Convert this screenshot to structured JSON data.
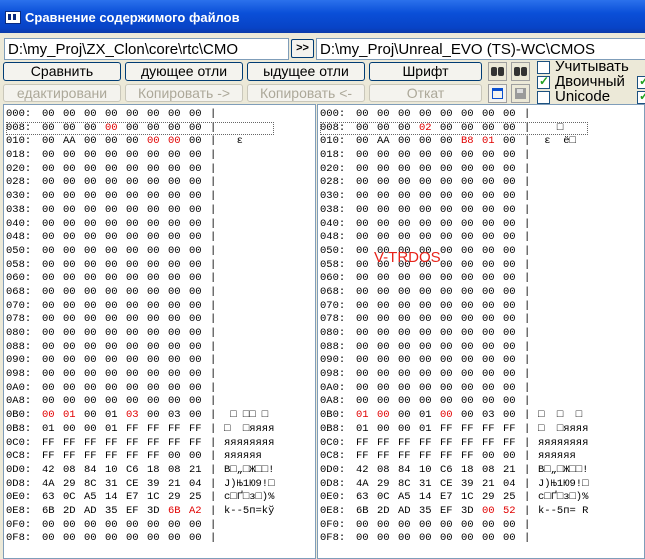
{
  "window": {
    "title": "Сравнение содержимого файлов"
  },
  "left_path": "D:\\my_Proj\\ZX_Clon\\core\\rtc\\CMO",
  "right_path": "D:\\my_Proj\\Unreal_EVO (TS)-WC\\CMOS",
  "swap_label": ">>",
  "buttons": {
    "compare": "Сравнить",
    "next_diff": "дующее отли",
    "prev_diff": "ыдущее отли",
    "font": "Шрифт",
    "edit": "едактировани",
    "copy_right": "Копировать ->",
    "copy_left": "Копировать <-",
    "rollback": "Откат"
  },
  "options": {
    "consider": {
      "label": "Учитывать",
      "checked": false
    },
    "binary": {
      "label": "Двоичный",
      "checked": true
    },
    "unicode": {
      "label": "Unicode",
      "checked": false
    }
  },
  "overlay_text": "V-TRDOS",
  "left_rows": [
    {
      "addr": "000:",
      "bytes": [
        "00",
        "00",
        "00",
        "00",
        "00",
        "00",
        "00",
        "00"
      ],
      "ascii": ""
    },
    {
      "addr": "008:",
      "bytes": [
        "00",
        "00",
        "00",
        "00",
        "00",
        "00",
        "00",
        "00"
      ],
      "ascii": ""
    },
    {
      "addr": "010:",
      "bytes": [
        "00",
        "AA",
        "00",
        "00",
        "00",
        "00",
        "00",
        "00"
      ],
      "ascii": "  ε"
    },
    {
      "addr": "018:",
      "bytes": [
        "00",
        "00",
        "00",
        "00",
        "00",
        "00",
        "00",
        "00"
      ],
      "ascii": ""
    },
    {
      "addr": "020:",
      "bytes": [
        "00",
        "00",
        "00",
        "00",
        "00",
        "00",
        "00",
        "00"
      ],
      "ascii": ""
    },
    {
      "addr": "028:",
      "bytes": [
        "00",
        "00",
        "00",
        "00",
        "00",
        "00",
        "00",
        "00"
      ],
      "ascii": ""
    },
    {
      "addr": "030:",
      "bytes": [
        "00",
        "00",
        "00",
        "00",
        "00",
        "00",
        "00",
        "00"
      ],
      "ascii": ""
    },
    {
      "addr": "038:",
      "bytes": [
        "00",
        "00",
        "00",
        "00",
        "00",
        "00",
        "00",
        "00"
      ],
      "ascii": ""
    },
    {
      "addr": "040:",
      "bytes": [
        "00",
        "00",
        "00",
        "00",
        "00",
        "00",
        "00",
        "00"
      ],
      "ascii": ""
    },
    {
      "addr": "048:",
      "bytes": [
        "00",
        "00",
        "00",
        "00",
        "00",
        "00",
        "00",
        "00"
      ],
      "ascii": ""
    },
    {
      "addr": "050:",
      "bytes": [
        "00",
        "00",
        "00",
        "00",
        "00",
        "00",
        "00",
        "00"
      ],
      "ascii": ""
    },
    {
      "addr": "058:",
      "bytes": [
        "00",
        "00",
        "00",
        "00",
        "00",
        "00",
        "00",
        "00"
      ],
      "ascii": ""
    },
    {
      "addr": "060:",
      "bytes": [
        "00",
        "00",
        "00",
        "00",
        "00",
        "00",
        "00",
        "00"
      ],
      "ascii": ""
    },
    {
      "addr": "068:",
      "bytes": [
        "00",
        "00",
        "00",
        "00",
        "00",
        "00",
        "00",
        "00"
      ],
      "ascii": ""
    },
    {
      "addr": "070:",
      "bytes": [
        "00",
        "00",
        "00",
        "00",
        "00",
        "00",
        "00",
        "00"
      ],
      "ascii": ""
    },
    {
      "addr": "078:",
      "bytes": [
        "00",
        "00",
        "00",
        "00",
        "00",
        "00",
        "00",
        "00"
      ],
      "ascii": ""
    },
    {
      "addr": "080:",
      "bytes": [
        "00",
        "00",
        "00",
        "00",
        "00",
        "00",
        "00",
        "00"
      ],
      "ascii": ""
    },
    {
      "addr": "088:",
      "bytes": [
        "00",
        "00",
        "00",
        "00",
        "00",
        "00",
        "00",
        "00"
      ],
      "ascii": ""
    },
    {
      "addr": "090:",
      "bytes": [
        "00",
        "00",
        "00",
        "00",
        "00",
        "00",
        "00",
        "00"
      ],
      "ascii": ""
    },
    {
      "addr": "098:",
      "bytes": [
        "00",
        "00",
        "00",
        "00",
        "00",
        "00",
        "00",
        "00"
      ],
      "ascii": ""
    },
    {
      "addr": "0A0:",
      "bytes": [
        "00",
        "00",
        "00",
        "00",
        "00",
        "00",
        "00",
        "00"
      ],
      "ascii": ""
    },
    {
      "addr": "0A8:",
      "bytes": [
        "00",
        "00",
        "00",
        "00",
        "00",
        "00",
        "00",
        "00"
      ],
      "ascii": ""
    },
    {
      "addr": "0B0:",
      "bytes": [
        "00",
        "01",
        "00",
        "01",
        "03",
        "00",
        "03",
        "00"
      ],
      "ascii": " □ □□ □"
    },
    {
      "addr": "0B8:",
      "bytes": [
        "01",
        "00",
        "00",
        "01",
        "FF",
        "FF",
        "FF",
        "FF"
      ],
      "ascii": "□  □яяяя"
    },
    {
      "addr": "0C0:",
      "bytes": [
        "FF",
        "FF",
        "FF",
        "FF",
        "FF",
        "FF",
        "FF",
        "FF"
      ],
      "ascii": "яяяяяяяя"
    },
    {
      "addr": "0C8:",
      "bytes": [
        "FF",
        "FF",
        "FF",
        "FF",
        "FF",
        "FF",
        "00",
        "00"
      ],
      "ascii": "яяяяяя"
    },
    {
      "addr": "0D0:",
      "bytes": [
        "42",
        "08",
        "84",
        "10",
        "C6",
        "18",
        "08",
        "21"
      ],
      "ascii": "B□„□Ж□□!"
    },
    {
      "addr": "0D8:",
      "bytes": [
        "4A",
        "29",
        "8C",
        "31",
        "CE",
        "39",
        "21",
        "04"
      ],
      "ascii": "J)Њ1Ю9!□"
    },
    {
      "addr": "0E0:",
      "bytes": [
        "63",
        "0C",
        "A5",
        "14",
        "E7",
        "1C",
        "29",
        "25"
      ],
      "ascii": "c□Ґ□з□)%"
    },
    {
      "addr": "0E8:",
      "bytes": [
        "6B",
        "2D",
        "AD",
        "35",
        "EF",
        "3D",
        "6B",
        "A2"
      ],
      "ascii": "k--5п=kў"
    },
    {
      "addr": "0F0:",
      "bytes": [
        "00",
        "00",
        "00",
        "00",
        "00",
        "00",
        "00",
        "00"
      ],
      "ascii": ""
    },
    {
      "addr": "0F8:",
      "bytes": [
        "00",
        "00",
        "00",
        "00",
        "00",
        "00",
        "00",
        "00"
      ],
      "ascii": ""
    }
  ],
  "right_rows": [
    {
      "addr": "000:",
      "bytes": [
        "00",
        "00",
        "00",
        "00",
        "00",
        "00",
        "00",
        "00"
      ],
      "ascii": ""
    },
    {
      "addr": "008:",
      "bytes": [
        "00",
        "00",
        "00",
        "02",
        "00",
        "00",
        "00",
        "00"
      ],
      "ascii": "   □"
    },
    {
      "addr": "010:",
      "bytes": [
        "00",
        "AA",
        "00",
        "00",
        "00",
        "B8",
        "01",
        "00"
      ],
      "ascii": " ε  ё□"
    },
    {
      "addr": "018:",
      "bytes": [
        "00",
        "00",
        "00",
        "00",
        "00",
        "00",
        "00",
        "00"
      ],
      "ascii": ""
    },
    {
      "addr": "020:",
      "bytes": [
        "00",
        "00",
        "00",
        "00",
        "00",
        "00",
        "00",
        "00"
      ],
      "ascii": ""
    },
    {
      "addr": "028:",
      "bytes": [
        "00",
        "00",
        "00",
        "00",
        "00",
        "00",
        "00",
        "00"
      ],
      "ascii": ""
    },
    {
      "addr": "030:",
      "bytes": [
        "00",
        "00",
        "00",
        "00",
        "00",
        "00",
        "00",
        "00"
      ],
      "ascii": ""
    },
    {
      "addr": "038:",
      "bytes": [
        "00",
        "00",
        "00",
        "00",
        "00",
        "00",
        "00",
        "00"
      ],
      "ascii": ""
    },
    {
      "addr": "040:",
      "bytes": [
        "00",
        "00",
        "00",
        "00",
        "00",
        "00",
        "00",
        "00"
      ],
      "ascii": ""
    },
    {
      "addr": "048:",
      "bytes": [
        "00",
        "00",
        "00",
        "00",
        "00",
        "00",
        "00",
        "00"
      ],
      "ascii": ""
    },
    {
      "addr": "050:",
      "bytes": [
        "00",
        "00",
        "00",
        "00",
        "00",
        "00",
        "00",
        "00"
      ],
      "ascii": ""
    },
    {
      "addr": "058:",
      "bytes": [
        "00",
        "00",
        "00",
        "00",
        "00",
        "00",
        "00",
        "00"
      ],
      "ascii": ""
    },
    {
      "addr": "060:",
      "bytes": [
        "00",
        "00",
        "00",
        "00",
        "00",
        "00",
        "00",
        "00"
      ],
      "ascii": ""
    },
    {
      "addr": "068:",
      "bytes": [
        "00",
        "00",
        "00",
        "00",
        "00",
        "00",
        "00",
        "00"
      ],
      "ascii": ""
    },
    {
      "addr": "070:",
      "bytes": [
        "00",
        "00",
        "00",
        "00",
        "00",
        "00",
        "00",
        "00"
      ],
      "ascii": ""
    },
    {
      "addr": "078:",
      "bytes": [
        "00",
        "00",
        "00",
        "00",
        "00",
        "00",
        "00",
        "00"
      ],
      "ascii": ""
    },
    {
      "addr": "080:",
      "bytes": [
        "00",
        "00",
        "00",
        "00",
        "00",
        "00",
        "00",
        "00"
      ],
      "ascii": ""
    },
    {
      "addr": "088:",
      "bytes": [
        "00",
        "00",
        "00",
        "00",
        "00",
        "00",
        "00",
        "00"
      ],
      "ascii": ""
    },
    {
      "addr": "090:",
      "bytes": [
        "00",
        "00",
        "00",
        "00",
        "00",
        "00",
        "00",
        "00"
      ],
      "ascii": ""
    },
    {
      "addr": "098:",
      "bytes": [
        "00",
        "00",
        "00",
        "00",
        "00",
        "00",
        "00",
        "00"
      ],
      "ascii": ""
    },
    {
      "addr": "0A0:",
      "bytes": [
        "00",
        "00",
        "00",
        "00",
        "00",
        "00",
        "00",
        "00"
      ],
      "ascii": ""
    },
    {
      "addr": "0A8:",
      "bytes": [
        "00",
        "00",
        "00",
        "00",
        "00",
        "00",
        "00",
        "00"
      ],
      "ascii": ""
    },
    {
      "addr": "0B0:",
      "bytes": [
        "01",
        "00",
        "00",
        "01",
        "00",
        "00",
        "03",
        "00"
      ],
      "ascii": "□  □  □"
    },
    {
      "addr": "0B8:",
      "bytes": [
        "01",
        "00",
        "00",
        "01",
        "FF",
        "FF",
        "FF",
        "FF"
      ],
      "ascii": "□  □яяяя"
    },
    {
      "addr": "0C0:",
      "bytes": [
        "FF",
        "FF",
        "FF",
        "FF",
        "FF",
        "FF",
        "FF",
        "FF"
      ],
      "ascii": "яяяяяяяя"
    },
    {
      "addr": "0C8:",
      "bytes": [
        "FF",
        "FF",
        "FF",
        "FF",
        "FF",
        "FF",
        "00",
        "00"
      ],
      "ascii": "яяяяяя"
    },
    {
      "addr": "0D0:",
      "bytes": [
        "42",
        "08",
        "84",
        "10",
        "C6",
        "18",
        "08",
        "21"
      ],
      "ascii": "B□„□Ж□□!"
    },
    {
      "addr": "0D8:",
      "bytes": [
        "4A",
        "29",
        "8C",
        "31",
        "CE",
        "39",
        "21",
        "04"
      ],
      "ascii": "J)Њ1Ю9!□"
    },
    {
      "addr": "0E0:",
      "bytes": [
        "63",
        "0C",
        "A5",
        "14",
        "E7",
        "1C",
        "29",
        "25"
      ],
      "ascii": "c□Ґ□з□)%"
    },
    {
      "addr": "0E8:",
      "bytes": [
        "6B",
        "2D",
        "AD",
        "35",
        "EF",
        "3D",
        "00",
        "52"
      ],
      "ascii": "k--5п= R"
    },
    {
      "addr": "0F0:",
      "bytes": [
        "00",
        "00",
        "00",
        "00",
        "00",
        "00",
        "00",
        "00"
      ],
      "ascii": ""
    },
    {
      "addr": "0F8:",
      "bytes": [
        "00",
        "00",
        "00",
        "00",
        "00",
        "00",
        "00",
        "00"
      ],
      "ascii": ""
    }
  ],
  "colors": {
    "diff": "#e00000",
    "titlebar": "#0a4fd8",
    "overlay": "#e8231a"
  }
}
